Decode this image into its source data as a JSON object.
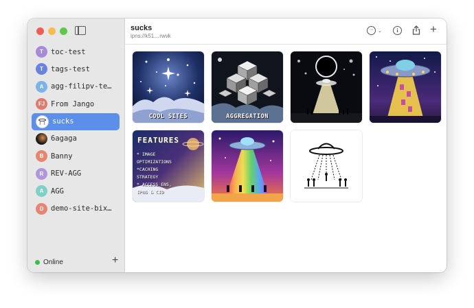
{
  "sidebar": {
    "sites": [
      {
        "label": "toc-test",
        "avatar": "T",
        "color": "#a58bd9"
      },
      {
        "label": "tags-test",
        "avatar": "T",
        "color": "#6b82e0"
      },
      {
        "label": "agg-filipv-te…",
        "avatar": "A",
        "color": "#7db3e8"
      },
      {
        "label": "From Jango",
        "avatar": "FJ",
        "color": "#e07a6a"
      },
      {
        "label": "sucks",
        "avatar": "ufo-thumbnail",
        "color": "#ffffff",
        "active": true
      },
      {
        "label": "6agaga",
        "avatar": "space-thumbnail",
        "color": "#222222"
      },
      {
        "label": "Banny",
        "avatar": "B",
        "color": "#e8856f"
      },
      {
        "label": "REV-AGG",
        "avatar": "R",
        "color": "#b095dc"
      },
      {
        "label": "AGG",
        "avatar": "A",
        "color": "#7fd1c5"
      },
      {
        "label": "demo-site-bix…",
        "avatar": "D",
        "color": "#e58572"
      }
    ],
    "status": "Online"
  },
  "header": {
    "title": "sucks",
    "subtitle": "ipns://k51…rwvk"
  },
  "tiles": [
    {
      "caption": "COOL SITES",
      "name": "cool-sites-tile"
    },
    {
      "caption": "AGGREGATION",
      "name": "aggregation-tile"
    },
    {
      "caption": "",
      "name": "eclipse-ufo-tile"
    },
    {
      "caption": "",
      "name": "ufo-abduction-tile"
    },
    {
      "heading": "FEATURES",
      "lines": [
        "* IMAGE",
        "OPTIMIZATIONS",
        "*CACHING",
        "STRATEGY",
        "* ACCESS ENS,",
        "IPNS & CID"
      ],
      "name": "features-tile"
    },
    {
      "caption": "",
      "name": "rainbow-ufo-tile"
    },
    {
      "caption": "",
      "name": "line-art-ufo-tile"
    }
  ]
}
